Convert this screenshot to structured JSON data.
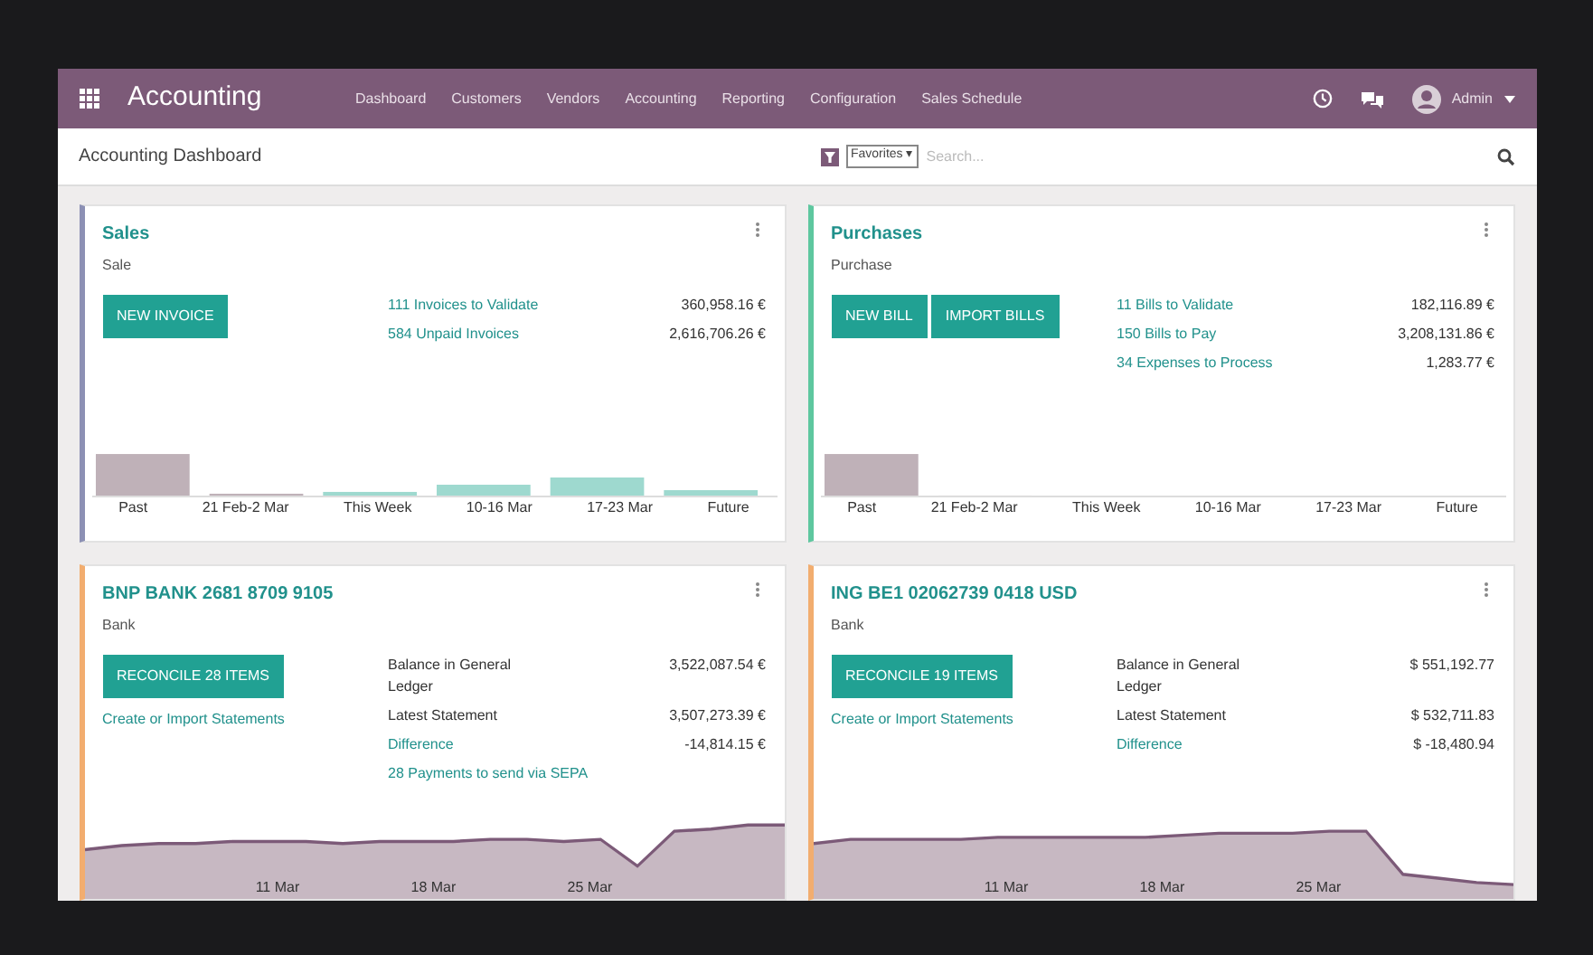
{
  "navbar": {
    "app_title": "Accounting",
    "menu": [
      "Dashboard",
      "Customers",
      "Vendors",
      "Accounting",
      "Reporting",
      "Configuration",
      "Sales Schedule"
    ],
    "user": "Admin"
  },
  "control_panel": {
    "breadcrumb": "Accounting Dashboard",
    "filter": "Favorites ▾",
    "search": {
      "placeholder": "Search..."
    }
  },
  "journals": [
    {
      "kind": "sale",
      "color": "#8c90b4",
      "title": "Sales",
      "subtitle": "Sale",
      "buttons": [
        "NEW INVOICE"
      ],
      "stats": [
        {
          "label": "111 Invoices to Validate",
          "value": "360,958.16 €"
        },
        {
          "label": "584 Unpaid Invoices",
          "value": "2,616,706.26 €"
        }
      ],
      "axis_labels": [
        "Past",
        "21 Feb-2 Mar",
        "This Week",
        "10-16 Mar",
        "17-23 Mar",
        "Future"
      ]
    },
    {
      "kind": "purchase",
      "color": "#5ec79f",
      "title": "Purchases",
      "subtitle": "Purchase",
      "buttons": [
        "NEW BILL",
        "IMPORT BILLS"
      ],
      "stats": [
        {
          "label": "11 Bills to Validate",
          "value": "182,116.89 €"
        },
        {
          "label": "150 Bills to Pay",
          "value": "3,208,131.86 €"
        },
        {
          "label": "34 Expenses to Process",
          "value": "1,283.77 €"
        }
      ],
      "axis_labels": [
        "Past",
        "21 Feb-2 Mar",
        "This Week",
        "10-16 Mar",
        "17-23 Mar",
        "Future"
      ]
    },
    {
      "kind": "bank",
      "color": "#f2ad6f",
      "title": "BNP BANK 2681 8709 9105",
      "subtitle": "Bank",
      "buttons": [
        "RECONCILE 28 ITEMS"
      ],
      "link": "Create or Import Statements",
      "balances": [
        {
          "label": "Balance in General Ledger",
          "value": "3,522,087.54 €"
        },
        {
          "label": "Latest Statement",
          "value": "3,507,273.39 €"
        }
      ],
      "difference": {
        "label": "Difference",
        "value": "-14,814.15 €"
      },
      "extra_link": "28 Payments to send via SEPA",
      "axis_labels": [
        "11 Mar",
        "18 Mar",
        "25 Mar"
      ]
    },
    {
      "kind": "bank",
      "color": "#f2ad6f",
      "title": "ING BE1 02062739 0418 USD",
      "subtitle": "Bank",
      "buttons": [
        "RECONCILE 19 ITEMS"
      ],
      "link": "Create or Import Statements",
      "balances": [
        {
          "label": "Balance in General Ledger",
          "value": "$ 551,192.77"
        },
        {
          "label": "Latest Statement",
          "value": "$ 532,711.83"
        }
      ],
      "difference": {
        "label": "Difference",
        "value": "$ -18,480.94"
      },
      "axis_labels": [
        "11 Mar",
        "18 Mar",
        "25 Mar"
      ]
    }
  ]
}
